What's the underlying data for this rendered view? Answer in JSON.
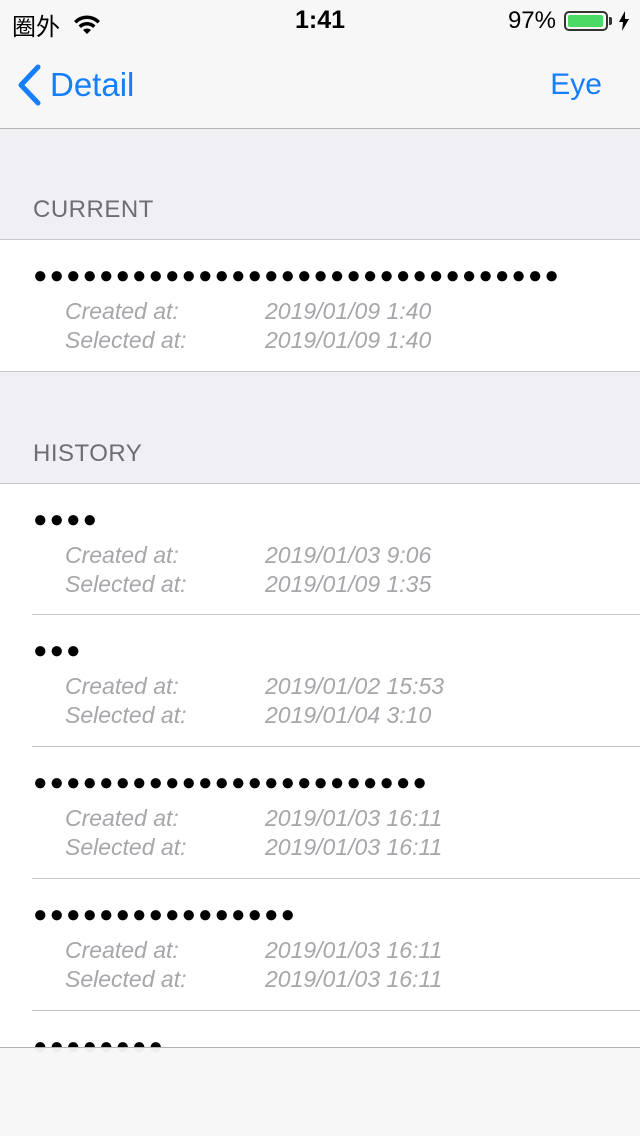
{
  "status_bar": {
    "carrier": "圈外",
    "time": "1:41",
    "battery_percent": "97%",
    "battery_level": 0.97,
    "battery_color": "#4cd964"
  },
  "nav": {
    "back_label": "Detail",
    "right_label": "Eye",
    "accent_color": "#147efb"
  },
  "current": {
    "header": "CURRENT",
    "items": [
      {
        "dots": "●●●●●●●●●●●●●●●●●●●●●●●●●●●●●●●●",
        "created_label": "Created at:",
        "created_value": "2019/01/09 1:40",
        "selected_label": "Selected at:",
        "selected_value": "2019/01/09 1:40"
      }
    ]
  },
  "history": {
    "header": "HISTORY",
    "items": [
      {
        "dots": "●●●●",
        "created_label": "Created at:",
        "created_value": "2019/01/03 9:06",
        "selected_label": "Selected at:",
        "selected_value": "2019/01/09 1:35"
      },
      {
        "dots": "●●●",
        "created_label": "Created at:",
        "created_value": "2019/01/02 15:53",
        "selected_label": "Selected at:",
        "selected_value": "2019/01/04 3:10"
      },
      {
        "dots": "●●●●●●●●●●●●●●●●●●●●●●●●",
        "created_label": "Created at:",
        "created_value": "2019/01/03 16:11",
        "selected_label": "Selected at:",
        "selected_value": "2019/01/03 16:11"
      },
      {
        "dots": "●●●●●●●●●●●●●●●●",
        "created_label": "Created at:",
        "created_value": "2019/01/03 16:11",
        "selected_label": "Selected at:",
        "selected_value": "2019/01/03 16:11"
      },
      {
        "dots": "●●●●●●●●",
        "created_label": "",
        "created_value": "",
        "selected_label": "",
        "selected_value": ""
      }
    ]
  }
}
